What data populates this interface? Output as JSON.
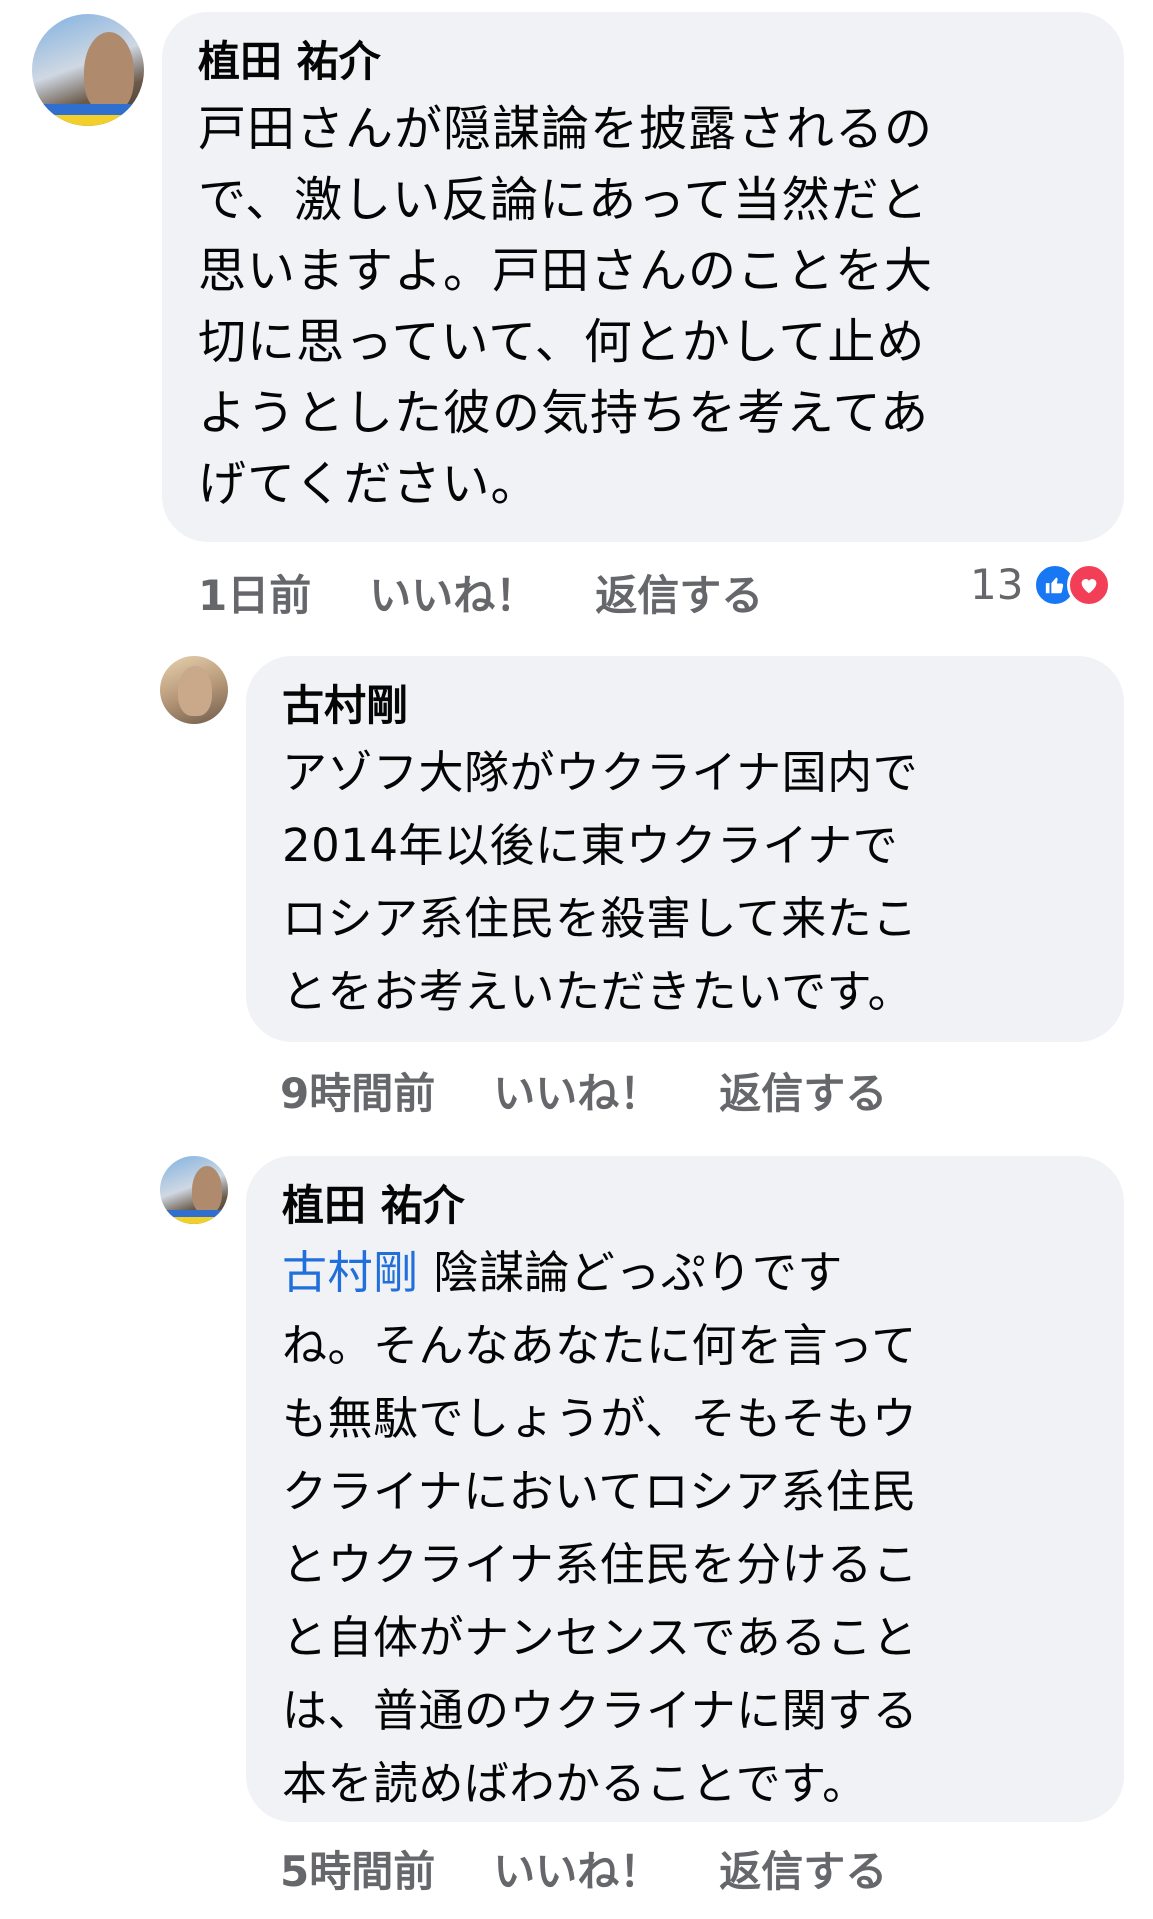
{
  "comments": [
    {
      "author": "植田 祐介",
      "text": "戸田さんが隠謀論を披露されるの\nで、激しい反論にあって当然だと\n思いますよ。戸田さんのことを大\n切に思っていて、何とかして止め\nようとした彼の気持ちを考えてあ\nげてください。",
      "time": "1日前",
      "like_label": "いいね！",
      "reply_label": "返信する",
      "reaction_count": "13",
      "reaction_icons": [
        "like-icon",
        "love-icon"
      ]
    },
    {
      "author": "古村剛",
      "text": "アゾフ大隊がウクライナ国内で\n2014年以後に東ウクライナで\nロシア系住民を殺害して来たこ\nとをお考えいただきたいです。",
      "time": "9時間前",
      "like_label": "いいね！",
      "reply_label": "返信する"
    },
    {
      "author": "植田 祐介",
      "mention": "古村剛",
      "text_first": " 陰謀論どっぷりです",
      "text": "ね。そんなあなたに何を言って\nも無駄でしょうが、そもそもウ\nクライナにおいてロシア系住民\nとウクライナ系住民を分けるこ\nと自体がナンセンスであること\nは、普通のウクライナに関する\n本を読めばわかることです。",
      "time": "5時間前",
      "like_label": "いいね！",
      "reply_label": "返信する"
    }
  ],
  "colors": {
    "bubble": "#f0f2f5",
    "mention": "#216fdb",
    "meta": "#65676b",
    "like": "#1877f2",
    "love": "#f33e58"
  }
}
